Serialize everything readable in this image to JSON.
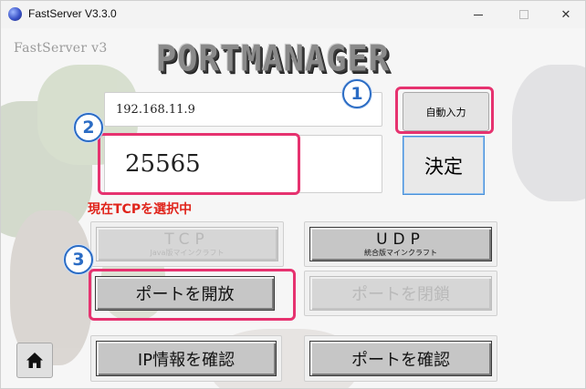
{
  "window": {
    "title": "FastServer V3.3.0"
  },
  "header": {
    "brand": "FastServer v3",
    "logo": "PORTMANAGER"
  },
  "form": {
    "ip_value": "192.168.11.9",
    "port_value": "25565",
    "auto_input_label": "自動入力",
    "confirm_label": "決定"
  },
  "status": {
    "text": "現在TCPを選択中",
    "color": "#e0241b"
  },
  "protocol": {
    "tcp_label": "TCP",
    "tcp_sub": "Java版マインクラフト",
    "udp_label": "UDP",
    "udp_sub": "統合版マインクラフト"
  },
  "actions": {
    "open_port_label": "ポートを開放",
    "close_port_label": "ポートを閉鎖",
    "ip_info_label": "IP情報を確認",
    "port_check_label": "ポートを確認"
  },
  "annotations": {
    "badge_1": "1",
    "badge_2": "2",
    "badge_3": "3",
    "highlight_color": "#e6326f",
    "badge_color": "#2b6cc4"
  },
  "icons": {
    "app": "fastserver-icon",
    "home": "home-icon"
  }
}
